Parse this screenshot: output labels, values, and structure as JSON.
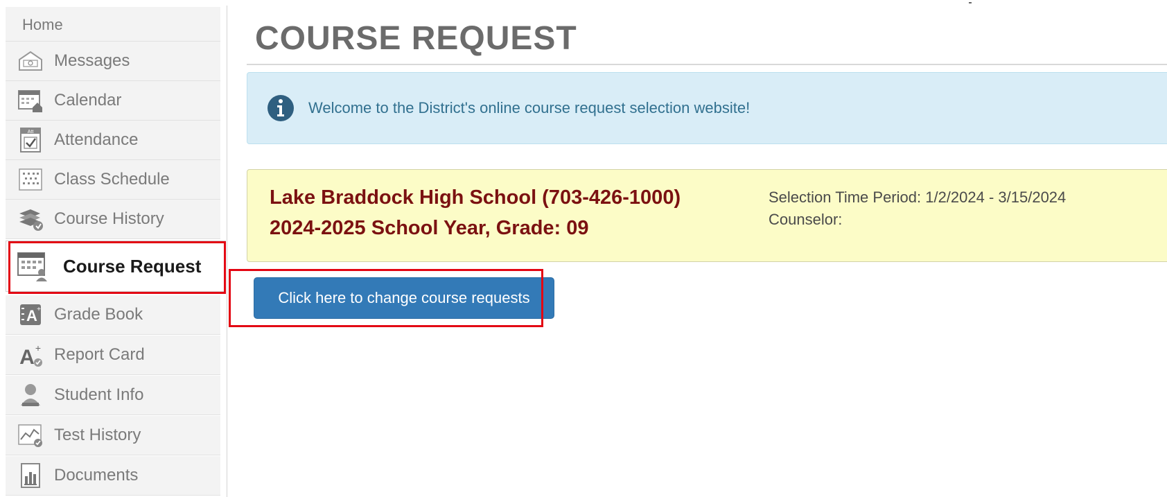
{
  "sidebar": {
    "items": [
      {
        "label": "Home",
        "icon": "home"
      },
      {
        "label": "Messages",
        "icon": "messages-icon"
      },
      {
        "label": "Calendar",
        "icon": "calendar-icon"
      },
      {
        "label": "Attendance",
        "icon": "attendance-icon"
      },
      {
        "label": "Class Schedule",
        "icon": "class-schedule-icon"
      },
      {
        "label": "Course History",
        "icon": "course-history-icon"
      },
      {
        "label": "Course Request",
        "icon": "course-request-icon",
        "active": true
      },
      {
        "label": "Grade Book",
        "icon": "grade-book-icon"
      },
      {
        "label": "Report Card",
        "icon": "report-card-icon"
      },
      {
        "label": "Student Info",
        "icon": "student-info-icon"
      },
      {
        "label": "Test History",
        "icon": "test-history-icon"
      },
      {
        "label": "Documents",
        "icon": "documents-icon"
      }
    ]
  },
  "main": {
    "title": "COURSE REQUEST",
    "info_message": "Welcome to the District's online course request selection website!",
    "school": {
      "name": "Lake Braddock High School (703-426-1000)",
      "year_grade": "2024-2025 School Year, Grade: 09",
      "selection_period": "Selection Time Period: 1/2/2024 - 3/15/2024",
      "counselor": "Counselor:"
    },
    "change_button": "Click here to change course requests"
  },
  "colors": {
    "accent_blue": "#337ab7",
    "info_bg": "#d9edf7",
    "school_bg": "#fcfcc7",
    "school_text": "#7b1111",
    "highlight_red": "#e30613"
  }
}
